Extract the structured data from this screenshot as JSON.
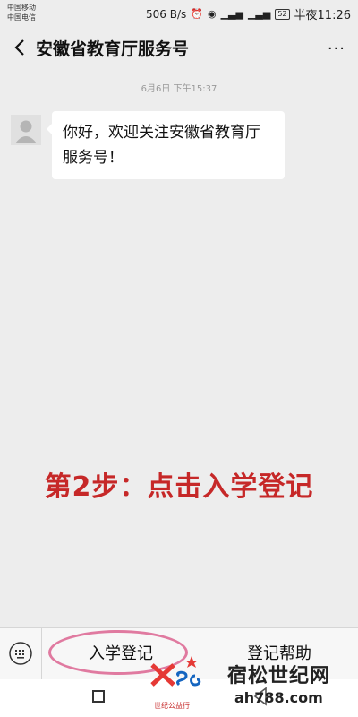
{
  "status_bar": {
    "carrier_1": "中国移动",
    "carrier_2": "中国电信",
    "speed": "506 B/s",
    "battery": "52",
    "time": "半夜11:26"
  },
  "header": {
    "title": "安徽省教育厅服务号",
    "more": "···"
  },
  "chat": {
    "timestamp": "6月6日 下午15:37",
    "messages": [
      {
        "text": "你好，欢迎关注安徽省教育厅服务号！"
      }
    ]
  },
  "overlay": {
    "instruction": "第2步：点击入学登记"
  },
  "bottom_menu": {
    "items": [
      {
        "label": "入学登记"
      },
      {
        "label": "登记帮助"
      }
    ]
  },
  "watermark": {
    "name": "宿松世纪网",
    "url": "ah788.com",
    "tag": "世纪公益行"
  },
  "colors": {
    "background": "#ededed",
    "overlay_text": "#c62828",
    "highlight": "#e07aa0"
  }
}
